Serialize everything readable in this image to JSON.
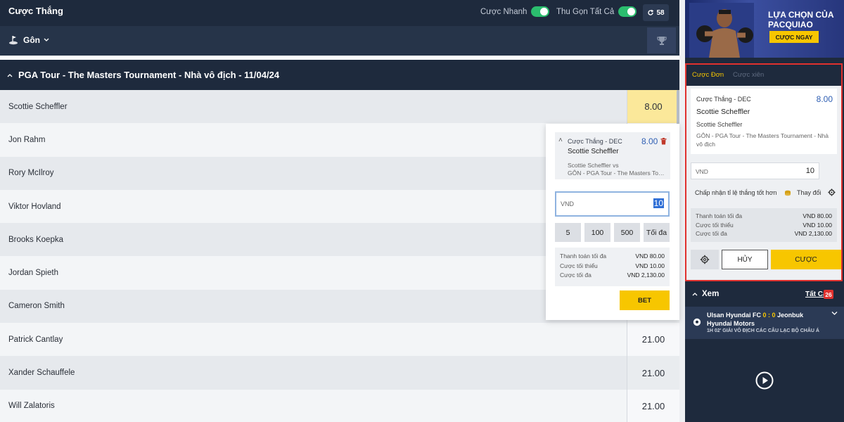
{
  "header": {
    "title": "Cược Thắng",
    "quick_bet_label": "Cược Nhanh",
    "collapse_all_label": "Thu Gọn Tất Cả",
    "refresh_count": "58"
  },
  "sport_bar": {
    "sport": "Gôn"
  },
  "event": {
    "title": "PGA Tour - The Masters Tournament - Nhà vô địch  - 11/04/24"
  },
  "players": [
    {
      "name": "Scottie Scheffler",
      "odds": "8.00"
    },
    {
      "name": "Jon Rahm",
      "odds": ""
    },
    {
      "name": "Rory McIlroy",
      "odds": ""
    },
    {
      "name": "Viktor Hovland",
      "odds": ""
    },
    {
      "name": "Brooks Koepka",
      "odds": ""
    },
    {
      "name": "Jordan Spieth",
      "odds": ""
    },
    {
      "name": "Cameron Smith",
      "odds": ""
    },
    {
      "name": "Patrick Cantlay",
      "odds": "21.00"
    },
    {
      "name": "Xander Schauffele",
      "odds": "21.00"
    },
    {
      "name": "Will Zalatoris",
      "odds": "21.00"
    }
  ],
  "quick_bet": {
    "market": "Cược Thắng - DEC",
    "odds": "8.00",
    "selection": "Scottie Scheffler",
    "line1": "Scottie Scheffler vs",
    "line2": "GÔN - PGA Tour - The Masters Tournament",
    "currency": "VND",
    "stake": "10",
    "quick_amounts": [
      "5",
      "100",
      "500",
      "Tối đa"
    ],
    "limits": [
      {
        "label": "Thanh toán tối đa",
        "value": "VND 80.00"
      },
      {
        "label": "Cược tối thiểu",
        "value": "VND 10.00"
      },
      {
        "label": "Cược tối đa",
        "value": "VND 2,130.00"
      }
    ],
    "bet_label": "BET"
  },
  "banner": {
    "line1": "LỰA CHỌN CỦA",
    "line2": "PACQUIAO",
    "cta": "CƯỢC NGAY"
  },
  "bet_slip": {
    "tab_single": "Cược Đơn",
    "tab_parlay": "Cược xiên",
    "market": "Cược Thắng - DEC",
    "odds": "8.00",
    "selection": "Scottie Scheffler",
    "sub": "Scottie Scheffler",
    "event": "GÔN - PGA Tour - The Masters Tournament - Nhà vô địch",
    "currency": "VND",
    "stake": "10",
    "accept_label": "Chấp nhận tỉ lệ thắng tốt hơn",
    "change_label": "Thay đổi",
    "limits": [
      {
        "label": "Thanh toán tối đa",
        "value": "VND 80.00"
      },
      {
        "label": "Cược tối thiểu",
        "value": "VND 10.00"
      },
      {
        "label": "Cược tối đa",
        "value": "VND 2,130.00"
      }
    ],
    "cancel_label": "HỦY",
    "bet_label": "CƯỢC"
  },
  "watch": {
    "title": "Xem",
    "all_label": "Tất Cả",
    "count": "26",
    "match": {
      "home": "Ulsan Hyundai FC",
      "score": "0 : 0",
      "away": "Jeonbuk Hyundai Motors",
      "meta": "1H 02' GIẢI VÔ ĐỊCH CÁC CÂU LẠC BỘ CHÂU Á"
    }
  },
  "colors": {
    "header_bg": "#1e2a3d",
    "accent_yellow": "#f7c600",
    "odds_selected": "#fbe89a",
    "toggle_on": "#2bbd6e",
    "slip_border": "#e0312e",
    "odds_text": "#2f5fb3"
  },
  "icons": {
    "sport": "golf-icon",
    "refresh": "refresh-icon",
    "trophy": "trophy-icon",
    "trash": "trash-icon",
    "settings": "gear-icon",
    "play": "play-icon",
    "ball": "soccer-ball-icon"
  }
}
